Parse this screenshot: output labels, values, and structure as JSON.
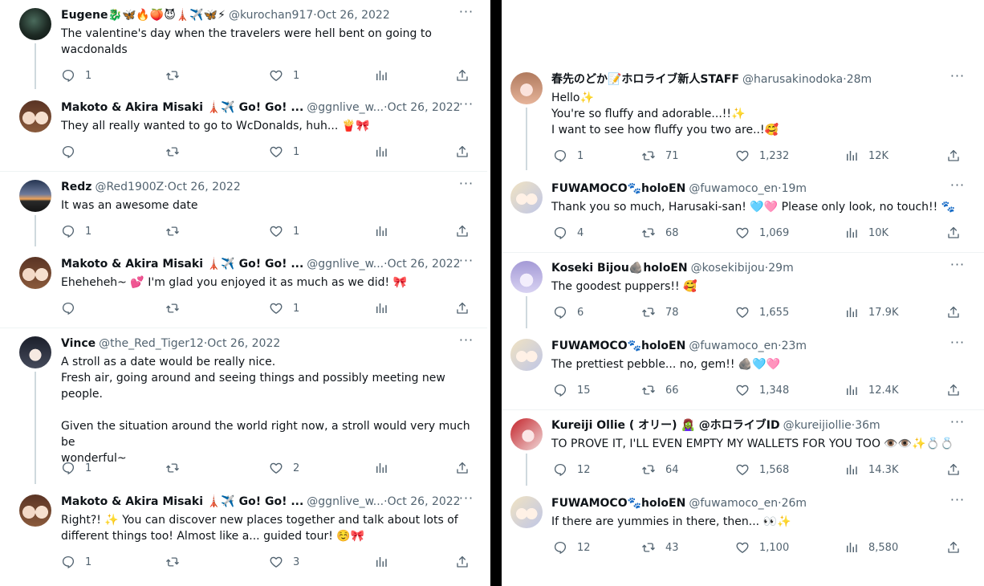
{
  "left": {
    "tweets": [
      {
        "name": "Eugene🐉🦋🔥🍑😈🗼✈️🦋⚡",
        "handle": "@kurochan917",
        "sep": " · ",
        "time": "Oct 26, 2022",
        "text": "The valentine's day when the travelers were hell bent on going to\nwacdonalds",
        "replies": "1",
        "retweets": "",
        "likes": "1",
        "views": "",
        "avatar": "avatar-dark"
      },
      {
        "name": "Makoto & Akira Misaki 🗼✈️ Go! Go! ...",
        "handle": "@ggnlive_w...",
        "sep": " · ",
        "time": "Oct 26, 2022",
        "text": "They all really wanted to go to WcDonalds, huh... 🍟🎀",
        "replies": "",
        "retweets": "",
        "likes": "1",
        "views": "",
        "avatar": "avatar-duo"
      },
      {
        "name": "Redz",
        "handle": "@Red1900Z",
        "sep": " · ",
        "time": "Oct 26, 2022",
        "text": "It was an awesome date",
        "replies": "1",
        "retweets": "",
        "likes": "1",
        "views": "",
        "avatar": "avatar-sunset"
      },
      {
        "name": "Makoto & Akira Misaki 🗼✈️ Go! Go! ...",
        "handle": "@ggnlive_w...",
        "sep": " · ",
        "time": "Oct 26, 2022",
        "text": "Eheheheh~ 💕 I'm glad you enjoyed it as much as we did! 🎀",
        "replies": "",
        "retweets": "",
        "likes": "1",
        "views": "",
        "avatar": "avatar-duo"
      },
      {
        "name": "Vince",
        "handle": "@the_Red_Tiger12",
        "sep": " · ",
        "time": "Oct 26, 2022",
        "text": "A stroll as a date would be really nice.\nFresh air, going around and seeing things and possibly meeting new\npeople.\n\nGiven the situation around the world right now, a stroll would very much be\nwonderful~",
        "replies": "1",
        "retweets": "",
        "likes": "2",
        "views": "",
        "avatar": "avatar-girl"
      },
      {
        "name": "Makoto & Akira Misaki 🗼✈️ Go! Go! ...",
        "handle": "@ggnlive_w...",
        "sep": " · ",
        "time": "Oct 26, 2022",
        "text": "Right?! ✨ You can discover new places together and talk about lots of\ndifferent things too! Almost like a... guided tour! ☺️🎀",
        "replies": "1",
        "retweets": "",
        "likes": "3",
        "views": "",
        "avatar": "avatar-duo"
      }
    ]
  },
  "right": {
    "tweets": [
      {
        "name": "春先のどか📝ホロライブ新人STAFF",
        "handle": "@harusakinodoka",
        "sep": " · ",
        "time": "28m",
        "text": "Hello✨\nYou're so fluffy and adorable...!!✨\nI want to see how fluffy you two are..!🥰",
        "replies": "1",
        "retweets": "71",
        "likes": "1,232",
        "views": "12K",
        "avatar": "avatar-pink"
      },
      {
        "name": "FUWAMOCO🐾holoEN",
        "handle": "@fuwamoco_en",
        "sep": " · ",
        "time": "19m",
        "text": "Thank you so much, Harusaki-san! 🩵🩷 Please only look, no touch!! 🐾",
        "replies": "4",
        "retweets": "68",
        "likes": "1,069",
        "views": "10K",
        "avatar": "avatar-blonde"
      },
      {
        "name": "Koseki Bijou🪨holoEN",
        "handle": "@kosekibijou",
        "sep": " · ",
        "time": "29m",
        "text": "The goodest puppers!! 🥰",
        "replies": "6",
        "retweets": "78",
        "likes": "1,655",
        "views": "17.9K",
        "avatar": "avatar-lilac"
      },
      {
        "name": "FUWAMOCO🐾holoEN",
        "handle": "@fuwamoco_en",
        "sep": " · ",
        "time": "23m",
        "text": "The prettiest pebble... no, gem!! 🪨🩵🩷",
        "replies": "15",
        "retweets": "66",
        "likes": "1,348",
        "views": "12.4K",
        "avatar": "avatar-blonde"
      },
      {
        "name": "Kureiji Ollie ( オリー) 🧟‍♀️ @ホロライブID",
        "handle": "@kureijiollie",
        "sep": " · ",
        "time": "36m",
        "text": "TO PROVE IT, I'LL EVEN EMPTY MY WALLETS FOR YOU TOO 👁️👁️✨💍💍",
        "replies": "12",
        "retweets": "64",
        "likes": "1,568",
        "views": "14.3K",
        "avatar": "avatar-red"
      },
      {
        "name": "FUWAMOCO🐾holoEN",
        "handle": "@fuwamoco_en",
        "sep": " · ",
        "time": "26m",
        "text": "If there are yummies in there, then... 👀✨",
        "replies": "12",
        "retweets": "43",
        "likes": "1,100",
        "views": "8,580",
        "avatar": "avatar-blonde"
      }
    ]
  },
  "icons": {
    "more": "more-icon",
    "reply": "reply-icon",
    "retweet": "retweet-icon",
    "like": "heart-icon",
    "views": "views-icon",
    "share": "share-icon"
  },
  "colors": {
    "text": "#0f1419",
    "muted": "#536471",
    "divider": "#000000",
    "thread": "#cfd9de"
  }
}
